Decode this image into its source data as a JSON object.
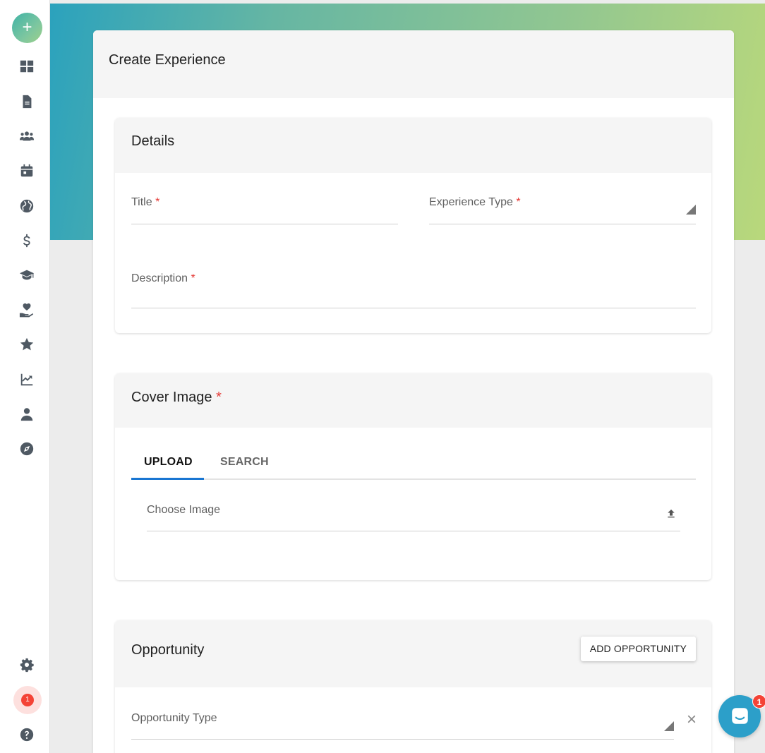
{
  "sidebar": {
    "add_label": "+",
    "nav_items": [
      "dashboard-icon",
      "document-icon",
      "users-icon",
      "calendar-icon",
      "globe-icon",
      "dollar-icon",
      "graduation-cap-icon",
      "hand-heart-icon",
      "star-icon",
      "chart-line-icon",
      "user-icon",
      "compass-icon"
    ],
    "settings_icon": "gear-icon",
    "notification_count": "1",
    "help_icon": "question-circle-icon"
  },
  "page": {
    "title": "Create Experience"
  },
  "details": {
    "heading": "Details",
    "title_label": "Title",
    "experience_type_label": "Experience Type",
    "description_label": "Description",
    "required_mark": "*"
  },
  "cover_image": {
    "heading": "Cover Image",
    "required_mark": "*",
    "tabs": [
      "UPLOAD",
      "SEARCH"
    ],
    "active_tab": "UPLOAD",
    "choose_label": "Choose Image"
  },
  "opportunity": {
    "heading": "Opportunity",
    "add_button": "ADD OPPORTUNITY",
    "type_label": "Opportunity Type",
    "close_glyph": "×"
  },
  "chat": {
    "badge_count": "1"
  },
  "colors": {
    "accent_blue": "#1976d2",
    "required_red": "#e53935",
    "chat_blue": "#2c9fc9",
    "icon_gray": "#4f5963"
  }
}
